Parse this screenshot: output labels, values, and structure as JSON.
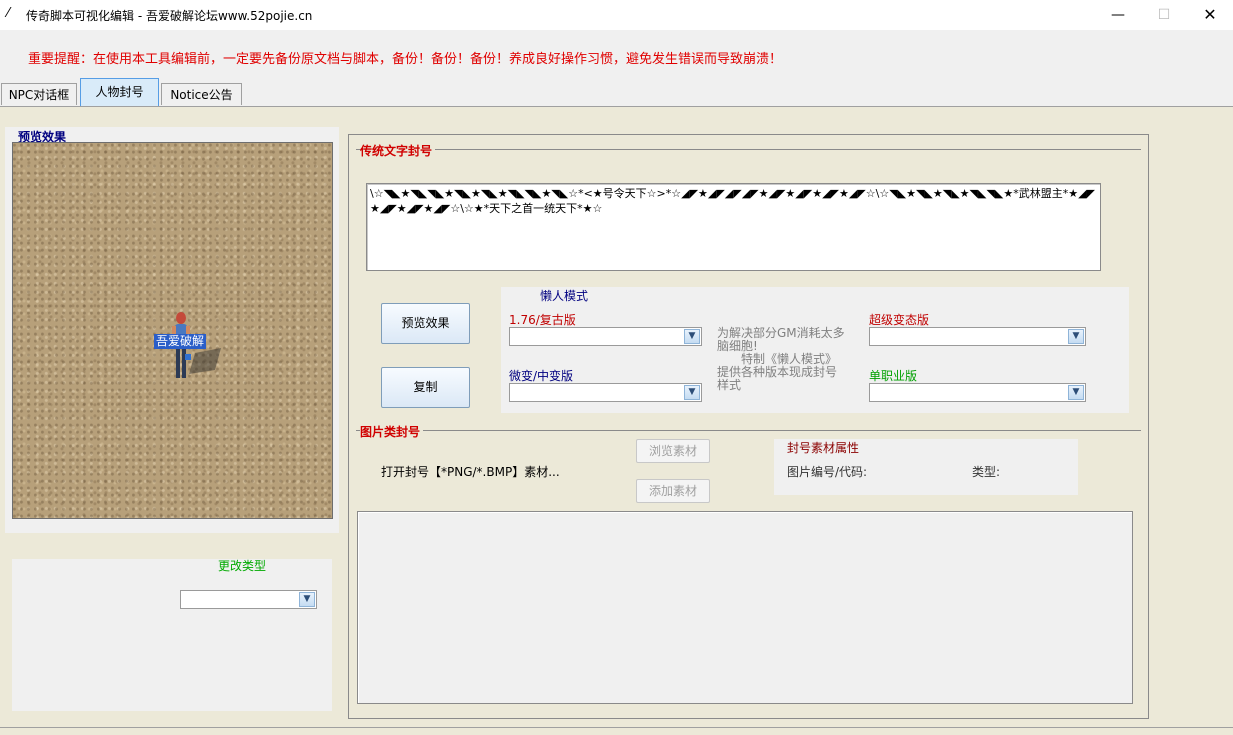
{
  "window": {
    "title": "传奇脚本可视化编辑 - 吾爱破解论坛www.52pojie.cn",
    "app_icon": "feather-icon",
    "minimize": "—",
    "maximize": "☐",
    "close": "✕"
  },
  "warning": "重要提醒：在使用本工具编辑前，一定要先备份原文档与脚本，备份！备份！备份！养成良好操作习惯，避免发生错误而导致崩溃！",
  "tabs": [
    {
      "label": "NPC对话框",
      "active": false
    },
    {
      "label": "人物封号",
      "active": true
    },
    {
      "label": "Notice公告",
      "active": false
    }
  ],
  "preview": {
    "caption": "预览效果",
    "character_label": "吾爱破解"
  },
  "change_type": {
    "caption": "更改类型",
    "selected": ""
  },
  "text_title": {
    "group_title": "传统文字封号",
    "content": "\\☆◥◣★◥◣◥◣★◥◣★◥◣★◥◣◥◣★◥◣☆*<★号令天下☆>*☆◢◤★◢◤◢◤◢◤★◢◤★◢◤★◢◤★◢◤☆\\☆◥◣★◥◣★◥◣★◥◣◥◣★*武林盟主*★◢◤★◢◤★◢◤★◢◤☆\\☆★*天下之首一统天下*★☆",
    "preview_button": "预览效果",
    "copy_button": "复制"
  },
  "lazy_mode": {
    "title": "懒人模式",
    "version_176_label": "1.76/复古版",
    "micro_change_label": "微变/中变版",
    "super_change_label": "超级变态版",
    "single_job_label": "单职业版",
    "description": "为解决部分GM消耗太多脑细胞!\n　　特制《懒人模式》　提供各种版本现成封号样式",
    "colors": {
      "version_176": "#c00000",
      "micro_change": "#000080",
      "super_change": "#c00000",
      "single_job": "#00a000"
    }
  },
  "image_title": {
    "group_title": "图片类封号",
    "open_label": "打开封号【*PNG/*.BMP】素材...",
    "browse_button": "浏览素材",
    "add_button": "添加素材",
    "attr_title": "封号素材属性",
    "image_code_label": "图片编号/代码:",
    "type_label": "类型:"
  }
}
